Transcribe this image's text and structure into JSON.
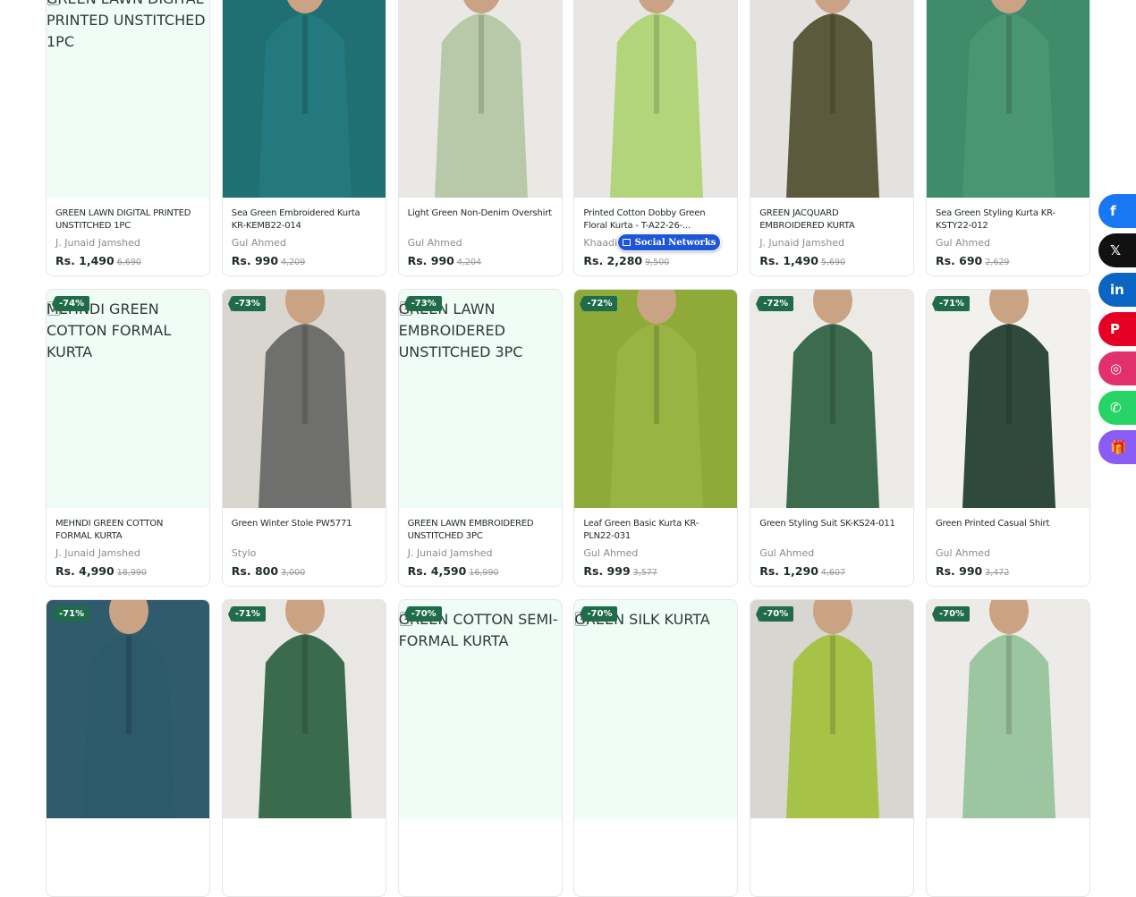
{
  "products": [
    {
      "image": "broken",
      "alt": "GREEN LAWN DIGITAL PRINTED UNSTITCHED 1PC",
      "badge": "",
      "title": "GREEN LAWN DIGITAL PRINTED UNSTITCHED 1PC",
      "brand": "J. Junaid Jamshed",
      "price": "Rs. 1,490",
      "old_price": "6,690",
      "bg": "#eef3f1",
      "garment": "#2f8e8c"
    },
    {
      "image": "photo",
      "badge": "",
      "title": "Sea Green Embroidered Kurta KR-KEMB22-014",
      "brand": "Gul Ahmed",
      "price": "Rs. 990",
      "old_price": "4,209",
      "bg": "#1f6f73",
      "garment": "#23797d"
    },
    {
      "image": "photo",
      "badge": "",
      "title": "Light Green Non-Denim Overshirt",
      "brand": "Gul Ahmed",
      "price": "Rs. 990",
      "old_price": "4,204",
      "bg": "#e9e8e4",
      "garment": "#b7c9a8"
    },
    {
      "image": "photo",
      "badge": "",
      "title": "Printed Cotton Dobby Green Floral Kurta - T-A22-26-...",
      "brand": "Khaadi",
      "price": "Rs. 2,280",
      "old_price": "9,500",
      "bg": "#e7e6e2",
      "garment": "#b2d47a"
    },
    {
      "image": "photo",
      "badge": "",
      "title": "GREEN JACQUARD EMBROIDERED KURTA",
      "brand": "J. Junaid Jamshed",
      "price": "Rs. 1,490",
      "old_price": "5,690",
      "bg": "#e4e2df",
      "garment": "#5b5a3c"
    },
    {
      "image": "photo",
      "badge": "",
      "title": "Sea Green Styling Kurta KR-KSTY22-012",
      "brand": "Gul Ahmed",
      "price": "Rs. 690",
      "old_price": "2,629",
      "bg": "#3f8b6a",
      "garment": "#4a9673"
    },
    {
      "image": "broken",
      "alt": "MEHNDI GREEN COTTON FORMAL KURTA",
      "badge": "-74%",
      "title": "MEHNDI GREEN COTTON FORMAL KURTA",
      "brand": "J. Junaid Jamshed",
      "price": "Rs. 4,990",
      "old_price": "18,990",
      "bg": "#eef3f1",
      "garment": "#6d7a3a"
    },
    {
      "image": "photo",
      "badge": "-73%",
      "title": "Green Winter Stole PW5771",
      "brand": "Stylo",
      "price": "Rs. 800",
      "old_price": "3,000",
      "bg": "#d9d5cf",
      "garment": "#6f706d"
    },
    {
      "image": "broken",
      "alt": "GREEN LAWN EMBROIDERED UNSTITCHED 3PC",
      "badge": "-73%",
      "title": "GREEN LAWN EMBROIDERED UNSTITCHED 3PC",
      "brand": "J. Junaid Jamshed",
      "price": "Rs. 4,590",
      "old_price": "16,990",
      "bg": "#eef3f1",
      "garment": "#7fb06f"
    },
    {
      "image": "photo",
      "badge": "-72%",
      "title": "Leaf Green Basic Kurta KR-PLN22-031",
      "brand": "Gul Ahmed",
      "price": "Rs. 999",
      "old_price": "3,577",
      "bg": "#8eab3a",
      "garment": "#98b443"
    },
    {
      "image": "photo",
      "badge": "-72%",
      "title": "Green Styling Suit SK-KS24-011",
      "brand": "Gul Ahmed",
      "price": "Rs. 1,290",
      "old_price": "4,607",
      "bg": "#eceae6",
      "garment": "#3d6b4e"
    },
    {
      "image": "photo",
      "badge": "-71%",
      "title": "Green Printed Casual Shirt",
      "brand": "Gul Ahmed",
      "price": "Rs. 990",
      "old_price": "3,472",
      "bg": "#f2f1ee",
      "garment": "#2f4a3c"
    },
    {
      "image": "photo",
      "badge": "-71%",
      "title": "",
      "brand": "",
      "price": "",
      "old_price": "",
      "bg": "#2f5b6c",
      "garment": "#2d5a6b"
    },
    {
      "image": "photo",
      "badge": "-71%",
      "title": "",
      "brand": "",
      "price": "",
      "old_price": "",
      "bg": "#e9e7e3",
      "garment": "#3b6b4d"
    },
    {
      "image": "broken",
      "alt": "GREEN COTTON SEMI-FORMAL KURTA",
      "badge": "-70%",
      "title": "",
      "brand": "",
      "price": "",
      "old_price": "",
      "bg": "#eef3f1",
      "garment": "#5f8a5a"
    },
    {
      "image": "broken",
      "alt": "GREEN SILK KURTA",
      "badge": "-70%",
      "title": "",
      "brand": "",
      "price": "",
      "old_price": "",
      "bg": "#eef3f1",
      "garment": "#557a4c"
    },
    {
      "image": "photo",
      "badge": "-70%",
      "title": "",
      "brand": "",
      "price": "",
      "old_price": "",
      "bg": "#d8d6d0",
      "garment": "#a6c347"
    },
    {
      "image": "photo",
      "badge": "-70%",
      "title": "",
      "brand": "",
      "price": "",
      "old_price": "",
      "bg": "#ecebe7",
      "garment": "#9cc6a0"
    }
  ],
  "social": [
    {
      "name": "facebook-icon",
      "glyph": "f",
      "color": "#1877f2"
    },
    {
      "name": "x-twitter-icon",
      "glyph": "𝕏",
      "color": "#111111"
    },
    {
      "name": "linkedin-icon",
      "glyph": "in",
      "color": "#0a66c2"
    },
    {
      "name": "pinterest-icon",
      "glyph": "P",
      "color": "#e60023"
    },
    {
      "name": "instagram-icon",
      "glyph": "◎",
      "color": "#e1306c"
    },
    {
      "name": "whatsapp-icon",
      "glyph": "✆",
      "color": "#25d366"
    },
    {
      "name": "gift-icon",
      "glyph": "🎁",
      "color": "#8a5cf6"
    }
  ],
  "overlay_badge": {
    "label": "Social Networks"
  }
}
